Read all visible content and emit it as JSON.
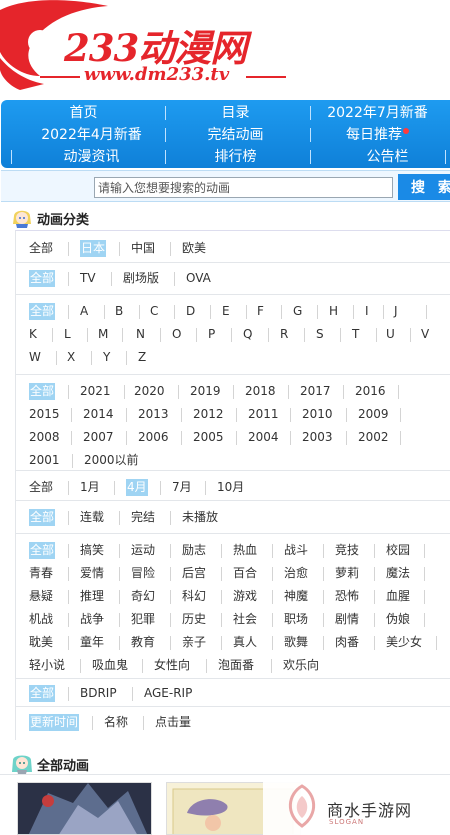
{
  "logo": {
    "title": "233动漫网",
    "url": "www.dm233.tv"
  },
  "nav": {
    "rows": [
      [
        {
          "label": "首页"
        },
        {
          "label": "目录"
        },
        {
          "label": "2022年7月新番"
        }
      ],
      [
        {
          "label": "2022年4月新番"
        },
        {
          "label": "完结动画"
        },
        {
          "label": "每日推荐"
        }
      ],
      [
        {
          "label": "动漫资讯"
        },
        {
          "label": "排行榜"
        },
        {
          "label": "公告栏"
        }
      ]
    ]
  },
  "search": {
    "placeholder": "请输入您想要搜索的动画",
    "button": "搜 索"
  },
  "sections": {
    "category": "动画分类",
    "all_anime": "全部动画"
  },
  "filters": {
    "region": [
      "全部",
      "日本",
      "中国",
      "欧美"
    ],
    "type": [
      "全部",
      "TV",
      "剧场版",
      "OVA"
    ],
    "letters": [
      "全部",
      "A",
      "B",
      "C",
      "D",
      "E",
      "F",
      "G",
      "H",
      "I",
      "J",
      "K",
      "L",
      "M",
      "N",
      "O",
      "P",
      "Q",
      "R",
      "S",
      "T",
      "U",
      "V",
      "W",
      "X",
      "Y",
      "Z"
    ],
    "years": [
      "全部",
      "2021",
      "2020",
      "2019",
      "2018",
      "2017",
      "2016",
      "2015",
      "2014",
      "2013",
      "2012",
      "2011",
      "2010",
      "2009",
      "2008",
      "2007",
      "2006",
      "2005",
      "2004",
      "2003",
      "2002",
      "2001",
      "2000以前"
    ],
    "months": [
      "全部",
      "1月",
      "4月",
      "7月",
      "10月"
    ],
    "status": [
      "全部",
      "连载",
      "完结",
      "未播放"
    ],
    "genres": [
      "全部",
      "搞笑",
      "运动",
      "励志",
      "热血",
      "战斗",
      "竞技",
      "校园",
      "青春",
      "爱情",
      "冒险",
      "后宫",
      "百合",
      "治愈",
      "萝莉",
      "魔法",
      "悬疑",
      "推理",
      "奇幻",
      "科幻",
      "游戏",
      "神魔",
      "恐怖",
      "血腥",
      "机战",
      "战争",
      "犯罪",
      "历史",
      "社会",
      "职场",
      "剧情",
      "伪娘",
      "耽美",
      "童年",
      "教育",
      "亲子",
      "真人",
      "歌舞",
      "肉番",
      "美少女",
      "轻小说",
      "吸血鬼",
      "女性向",
      "泡面番",
      "欢乐向"
    ],
    "resource": [
      "全部",
      "BDRIP",
      "AGE-RIP"
    ],
    "sort": [
      "更新时间",
      "名称",
      "点击量"
    ]
  },
  "watermark": {
    "text": "商水手游网",
    "sub": "SLOGAN"
  },
  "colors": {
    "nav_blue": "#1a8ae6",
    "logo_red": "#e5252b",
    "selected": "#9fd4f3"
  }
}
